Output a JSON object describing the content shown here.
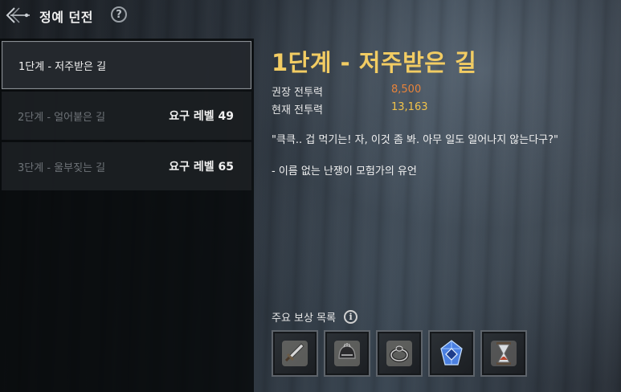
{
  "header": {
    "title": "정예 던전",
    "help_glyph": "?"
  },
  "stages": [
    {
      "name": "1단계 - 저주받은 길",
      "requirement": "",
      "selected": true
    },
    {
      "name": "2단계 - 얼어붙은 길",
      "requirement": "요구 레벨 49",
      "selected": false
    },
    {
      "name": "3단계 - 울부짖는 길",
      "requirement": "요구 레벨 65",
      "selected": false
    }
  ],
  "detail": {
    "title": "1단계 - 저주받은 길",
    "recommended_power_label": "권장 전투력",
    "recommended_power_value": "8,500",
    "current_power_label": "현재 전투력",
    "current_power_value": "13,163",
    "quote": "\"큭큭.. 겁 먹기는! 자, 이것 좀 봐. 아무 일도 일어나지 않는다구?\"",
    "source": "- 이름 없는 난쟁이 모험가의 유언"
  },
  "rewards": {
    "title": "주요 보상 목록",
    "info_glyph": "i",
    "items": [
      "sword-icon",
      "helmet-icon",
      "ring-icon",
      "blue-crystal-icon",
      "hourglass-icon"
    ]
  },
  "colors": {
    "title_gold": "#f2cc63",
    "recommended_orange": "#e8833a",
    "current_yellow": "#f0c24a"
  }
}
